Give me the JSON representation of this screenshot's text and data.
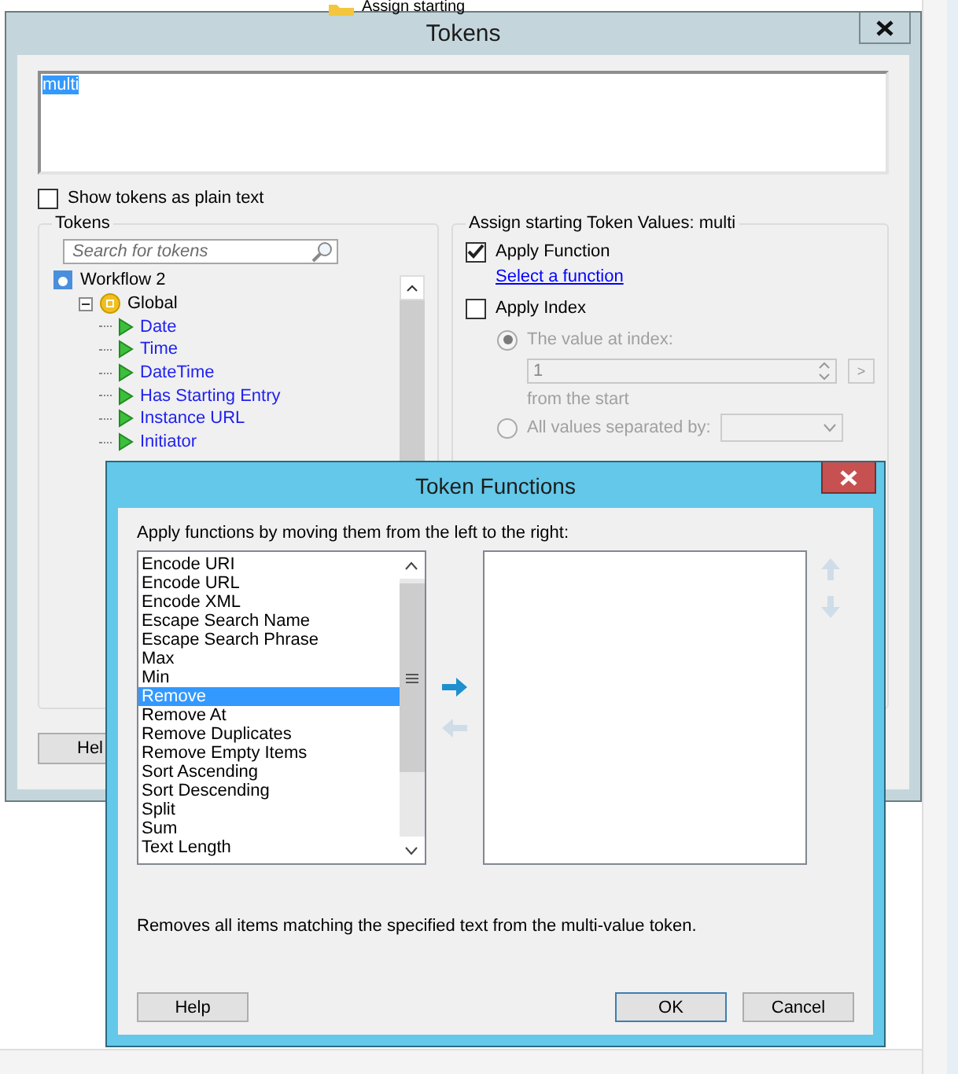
{
  "background_app": {
    "label": "Assign starting"
  },
  "tokens_window": {
    "title": "Tokens",
    "expression": {
      "value": "multi",
      "selected": true
    },
    "show_plain_text": {
      "label": "Show tokens as plain text",
      "checked": false
    },
    "tokens_group": {
      "title": "Tokens",
      "search": {
        "placeholder": "Search for tokens"
      },
      "tree": [
        {
          "label": "Workflow 2",
          "kind": "workflow",
          "children": [
            {
              "label": "Global",
              "kind": "group",
              "expanded": true,
              "children": [
                {
                  "label": "Date",
                  "kind": "token"
                },
                {
                  "label": "Time",
                  "kind": "token"
                },
                {
                  "label": "DateTime",
                  "kind": "token"
                },
                {
                  "label": "Has Starting Entry",
                  "kind": "token"
                },
                {
                  "label": "Instance URL",
                  "kind": "token"
                },
                {
                  "label": "Initiator",
                  "kind": "token"
                }
              ]
            }
          ]
        }
      ]
    },
    "assign_group": {
      "title": "Assign starting Token Values: multi",
      "apply_function": {
        "label": "Apply Function",
        "checked": true
      },
      "select_link": "Select a function",
      "apply_index": {
        "label": "Apply Index",
        "checked": false
      },
      "index_options": [
        {
          "label": "The value at index:",
          "selected": true,
          "disabled": true
        },
        {
          "label": "All values separated by:",
          "selected": false,
          "disabled": true
        }
      ],
      "index_value": "1",
      "from_text": "from the  start",
      "go_button": ">"
    },
    "help_button": "Hel"
  },
  "functions_dialog": {
    "title": "Token Functions",
    "instruction": "Apply functions by moving them from the left to the right:",
    "available": [
      {
        "label": "Encode URI",
        "selected": false
      },
      {
        "label": "Encode URL",
        "selected": false
      },
      {
        "label": "Encode XML",
        "selected": false
      },
      {
        "label": "Escape Search Name",
        "selected": false
      },
      {
        "label": "Escape Search Phrase",
        "selected": false
      },
      {
        "label": "Max",
        "selected": false
      },
      {
        "label": "Min",
        "selected": false
      },
      {
        "label": "Remove",
        "selected": true
      },
      {
        "label": "Remove At",
        "selected": false
      },
      {
        "label": "Remove Duplicates",
        "selected": false
      },
      {
        "label": "Remove Empty Items",
        "selected": false
      },
      {
        "label": "Sort Ascending",
        "selected": false
      },
      {
        "label": "Sort Descending",
        "selected": false
      },
      {
        "label": "Split",
        "selected": false
      },
      {
        "label": "Sum",
        "selected": false
      },
      {
        "label": "Text Length",
        "selected": false
      }
    ],
    "description": "Removes all items matching the specified text from the multi-value token.",
    "buttons": [
      {
        "label": "Help",
        "kind": "help"
      },
      {
        "label": "OK",
        "kind": "default"
      },
      {
        "label": "Cancel",
        "kind": "cancel"
      }
    ]
  }
}
